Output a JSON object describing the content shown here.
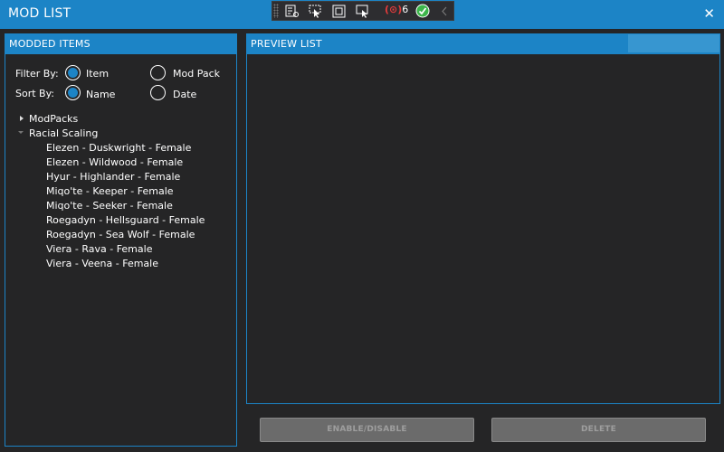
{
  "window": {
    "title": "MOD LIST",
    "close_glyph": "✕"
  },
  "debug_toolbar": {
    "binding_error_count": "6"
  },
  "left_panel": {
    "header": "MODDED ITEMS",
    "filter_label": "Filter By:",
    "filter_options": [
      "Item",
      "Mod Pack"
    ],
    "filter_selected": "Item",
    "sort_label": "Sort By:",
    "sort_options": [
      "Name",
      "Date"
    ],
    "sort_selected": "Name",
    "tree": [
      {
        "label": "ModPacks",
        "expanded": false,
        "children": []
      },
      {
        "label": "Racial Scaling",
        "expanded": true,
        "children": [
          "Elezen - Duskwright - Female",
          "Elezen - Wildwood - Female",
          "Hyur - Highlander - Female",
          "Miqo'te - Keeper - Female",
          "Miqo'te - Seeker - Female",
          "Roegadyn - Hellsguard - Female",
          "Roegadyn - Sea Wolf - Female",
          "Viera - Rava - Female",
          "Viera - Veena - Female"
        ]
      }
    ]
  },
  "right_panel": {
    "header": "PREVIEW LIST"
  },
  "buttons": {
    "enable_disable": "ENABLE/DISABLE",
    "delete": "DELETE"
  },
  "colors": {
    "accent": "#1c84c6",
    "background": "#252526",
    "button_disabled": "#6b6b6b"
  },
  "icons": [
    "grip-icon",
    "select-element-icon",
    "pointer-icon",
    "adorner-icon",
    "track-focus-icon",
    "binding-error-icon",
    "check-icon",
    "collapse-chevron-icon",
    "close-icon"
  ]
}
